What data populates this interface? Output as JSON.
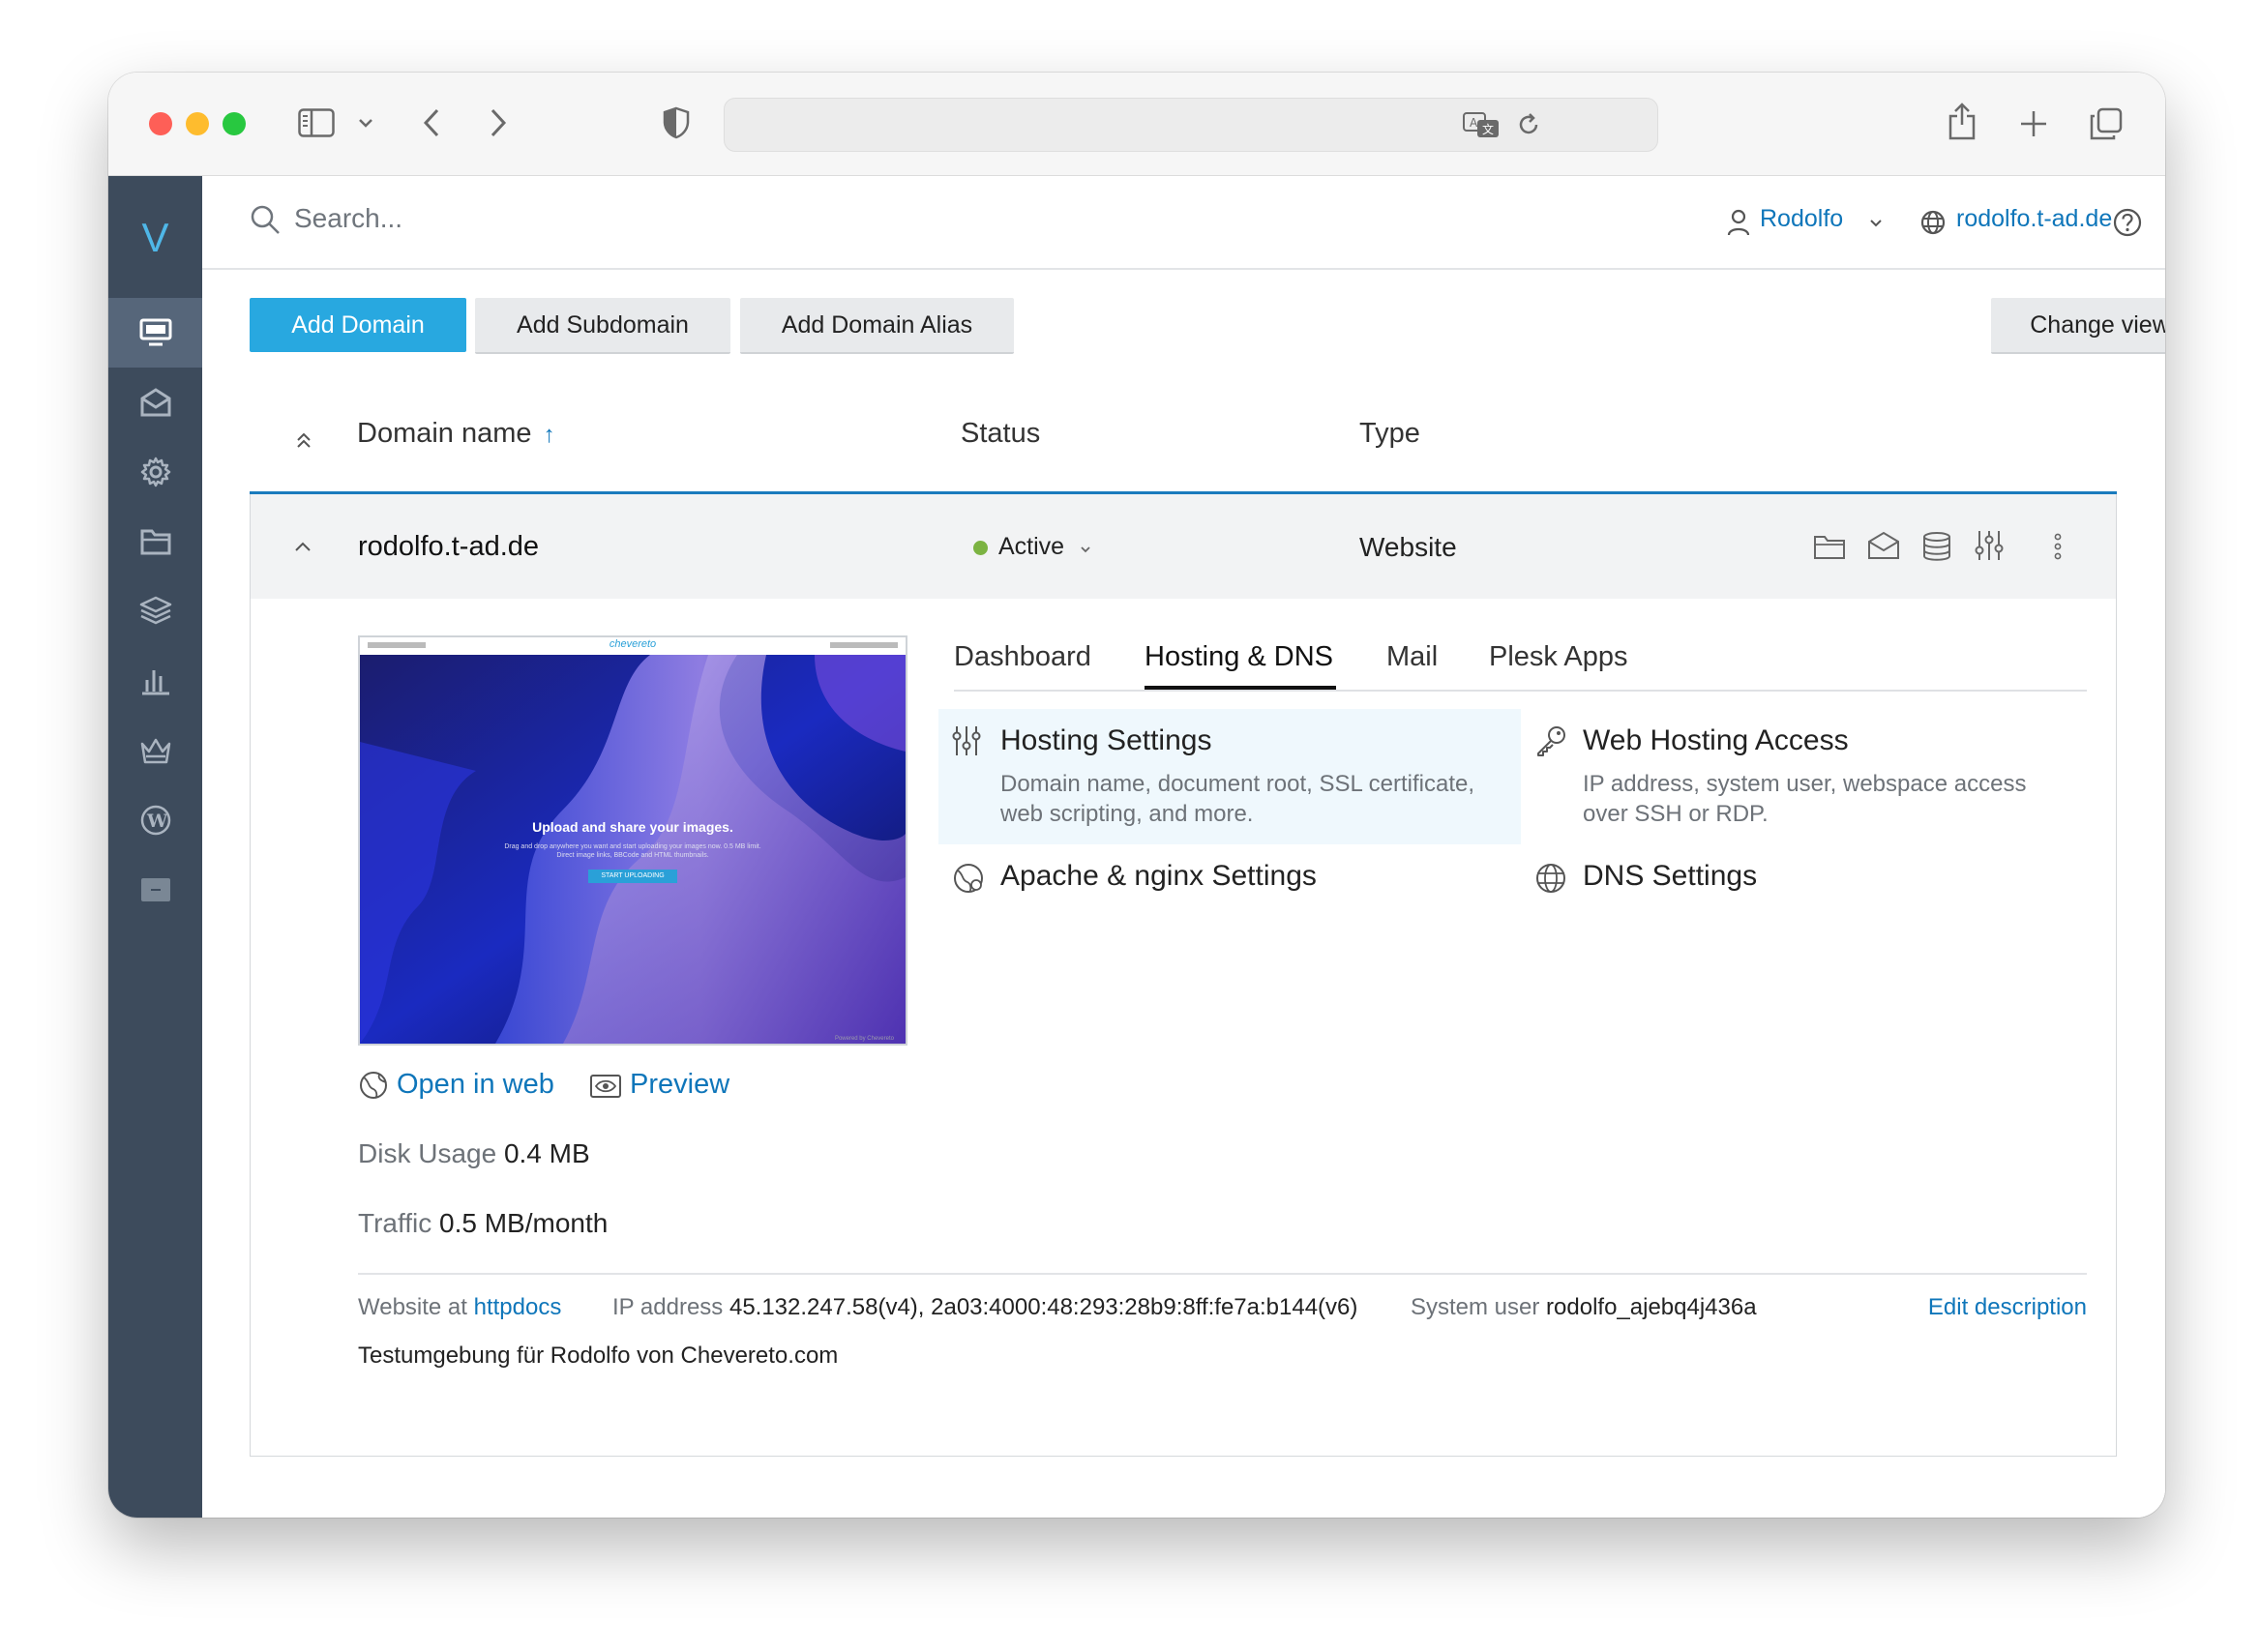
{
  "topbar": {
    "search_placeholder": "Search...",
    "user_name": "Rodolfo",
    "domain_link": "rodolfo.t-ad.de"
  },
  "sidebar": {
    "logo": "V",
    "items": [
      "websites-domains",
      "mail",
      "applications",
      "file-manager",
      "databases",
      "statistics",
      "extensions-crown",
      "wordpress",
      "file-sharing"
    ]
  },
  "actions": {
    "add_domain": "Add Domain",
    "add_subdomain": "Add Subdomain",
    "add_domain_alias": "Add Domain Alias",
    "change_view": "Change view"
  },
  "table": {
    "col_domain": "Domain name",
    "sort_arrow": "↑",
    "col_status": "Status",
    "col_type": "Type"
  },
  "domain": {
    "name": "rodolfo.t-ad.de",
    "status": "Active",
    "type": "Website",
    "preview": {
      "site_logo": "chevereto",
      "headline": "Upload and share your images.",
      "subtext": "Drag and drop anywhere you want and start uploading your images now. 0.5 MB limit. Direct image links, BBCode and HTML thumbnails.",
      "cta": "START UPLOADING",
      "footer": "Powered by Chevereto"
    },
    "open_in_web": "Open in web",
    "preview_label": "Preview",
    "disk_usage_label": "Disk Usage",
    "disk_usage_value": "0.4 MB",
    "traffic_label": "Traffic",
    "traffic_value": "0.5 MB/month",
    "tabs": [
      "Dashboard",
      "Hosting & DNS",
      "Mail",
      "Plesk Apps"
    ],
    "active_tab": "Hosting & DNS",
    "tiles": {
      "hosting_settings": {
        "title": "Hosting Settings",
        "desc": "Domain name, document root, SSL certificate, web scripting, and more."
      },
      "web_hosting_access": {
        "title": "Web Hosting Access",
        "desc": "IP address, system user, webspace access over SSH or RDP."
      },
      "apache_nginx": {
        "title": "Apache & nginx Settings"
      },
      "dns": {
        "title": "DNS Settings"
      }
    },
    "footer": {
      "website_at_label": "Website at",
      "website_at_link": "httpdocs",
      "ip_label": "IP address",
      "ip_value": "45.132.247.58(v4), 2a03:4000:48:293:28b9:8ff:fe7a:b144(v6)",
      "sysuser_label": "System user",
      "sysuser_value": "rodolfo_ajebq4j436a",
      "edit_description": "Edit description",
      "description": "Testumgebung für Rodolfo von Chevereto.com"
    }
  },
  "colors": {
    "sidebar": "#3d4b5c",
    "accent_blue": "#28a8e0",
    "link_blue": "#0f76ba",
    "status_green": "#7cb342"
  }
}
